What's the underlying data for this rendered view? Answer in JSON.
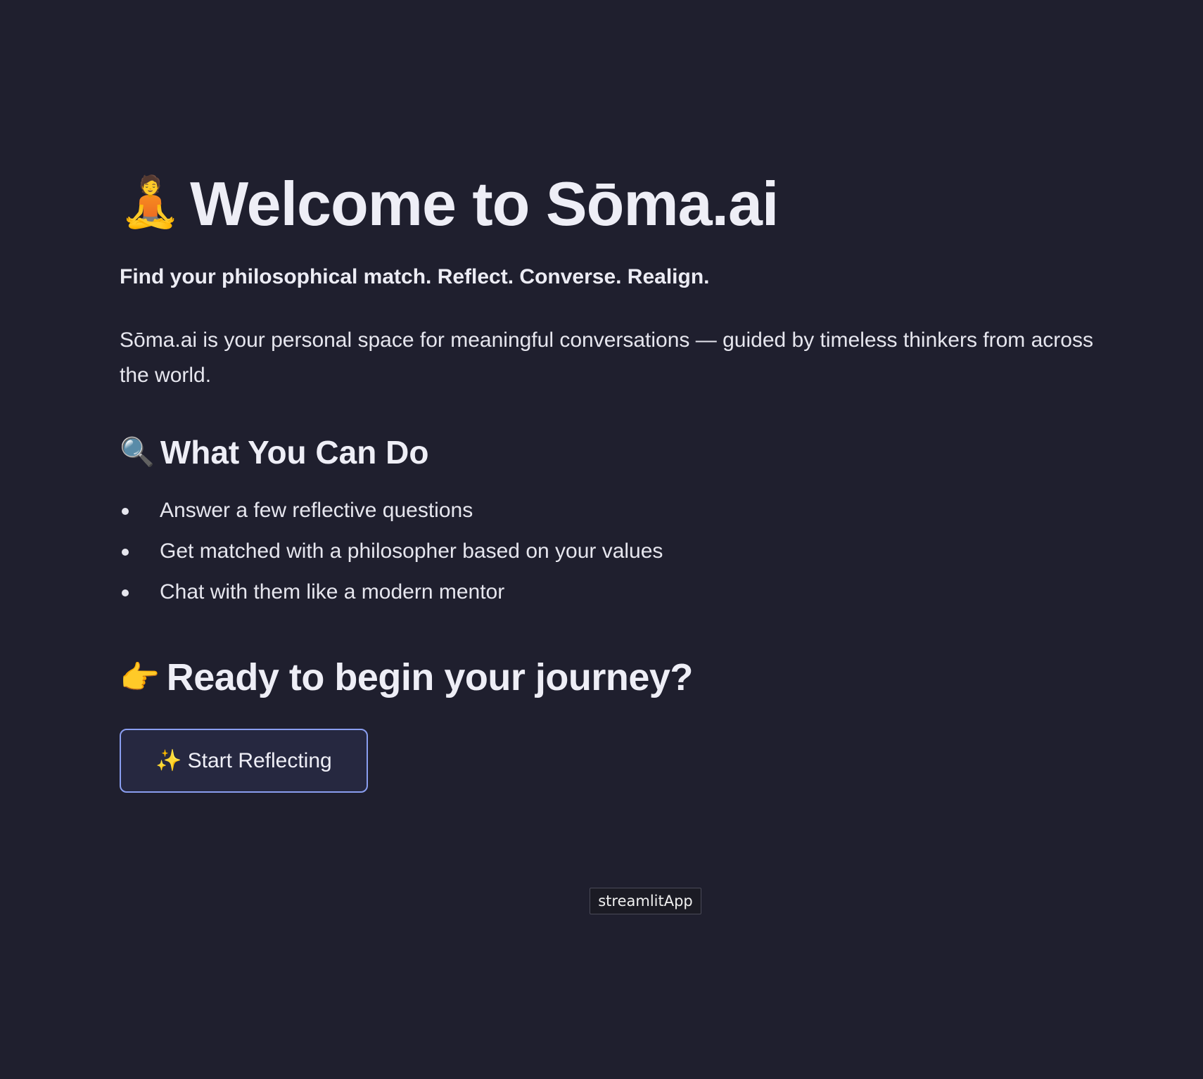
{
  "header": {
    "title_icon": "🧘",
    "title": "Welcome to Sōma.ai",
    "tagline": "Find your philosophical match. Reflect. Converse. Realign."
  },
  "intro": {
    "text": "Sōma.ai is your personal space for meaningful conversations — guided by timeless thinkers from across the world."
  },
  "features": {
    "heading_icon": "🔍",
    "heading": "What You Can Do",
    "items": [
      {
        "label": "Answer a few reflective questions"
      },
      {
        "label": "Get matched with a philosopher based on your values"
      },
      {
        "label": "Chat with them like a modern mentor"
      }
    ]
  },
  "cta": {
    "heading_icon": "👉",
    "heading": "Ready to begin your journey?",
    "button_icon": "✨",
    "button_label": "Start Reflecting"
  },
  "tooltip": {
    "text": "streamlitApp"
  },
  "colors": {
    "background": "#1f1f2e",
    "text": "#eeeef6",
    "button_border": "#8a9ef0",
    "button_bg": "#262840"
  }
}
